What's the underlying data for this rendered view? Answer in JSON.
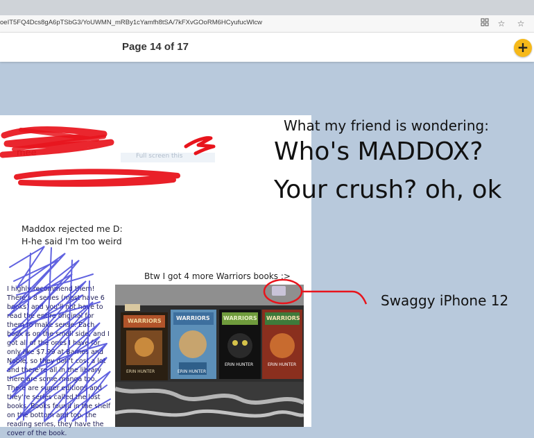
{
  "browser": {
    "url": "oeIT5FQ4Dcs8gA6pTSbG3/YoUWMN_mRBy1cYamfh8tSA/7kFXvGOoRM6HCyufucWlcw",
    "icons": [
      "reader-mode-icon",
      "favorite-icon",
      "favorites-list-icon"
    ]
  },
  "viewer": {
    "page_indicator": "Page 14 of 17",
    "add_button": "+"
  },
  "page": {
    "redacted_name_fragment": "mee",
    "faint_caption": "Full screen this",
    "maddox_line1": "Maddox rejected me D:",
    "maddox_line2": "H-he said I'm too weird",
    "warriors_caption": "Btw I got 4 more Warriors books :>",
    "scribbled_text": "I highly recommend them! There's 8 series (most have 6 books) and you'll not have to read the entire original for them to make sense. Each book is on the small side, and I got all of the ones I have for only like $7.99 at Barnes and Noble, so they don't cost a lot and there're all in the library there are some manga too. There are super editions and they're series called the lost books. Books found in the shelf on the bottom and top. the reading series, they have the cover of the book.",
    "book_titles": [
      "WARRIORS",
      "WARRIORS",
      "WARRIORS",
      "WARRIORS"
    ],
    "book_authors": [
      "ERIN HUNTER",
      "ERIN HUNTER",
      "ERIN HUNTER",
      "ERIN HUNTER"
    ]
  },
  "annotations": {
    "friend_heading": "What my friend is wondering:",
    "question1": "Who's MADDOX?",
    "question2": "Your crush? oh, ok",
    "phone_label": "Swaggy iPhone 12"
  },
  "colors": {
    "background": "#b8c9dc",
    "accent": "#f6b91a",
    "scribble_red": "#e8141c",
    "scribble_blue": "#2d2fd6"
  }
}
